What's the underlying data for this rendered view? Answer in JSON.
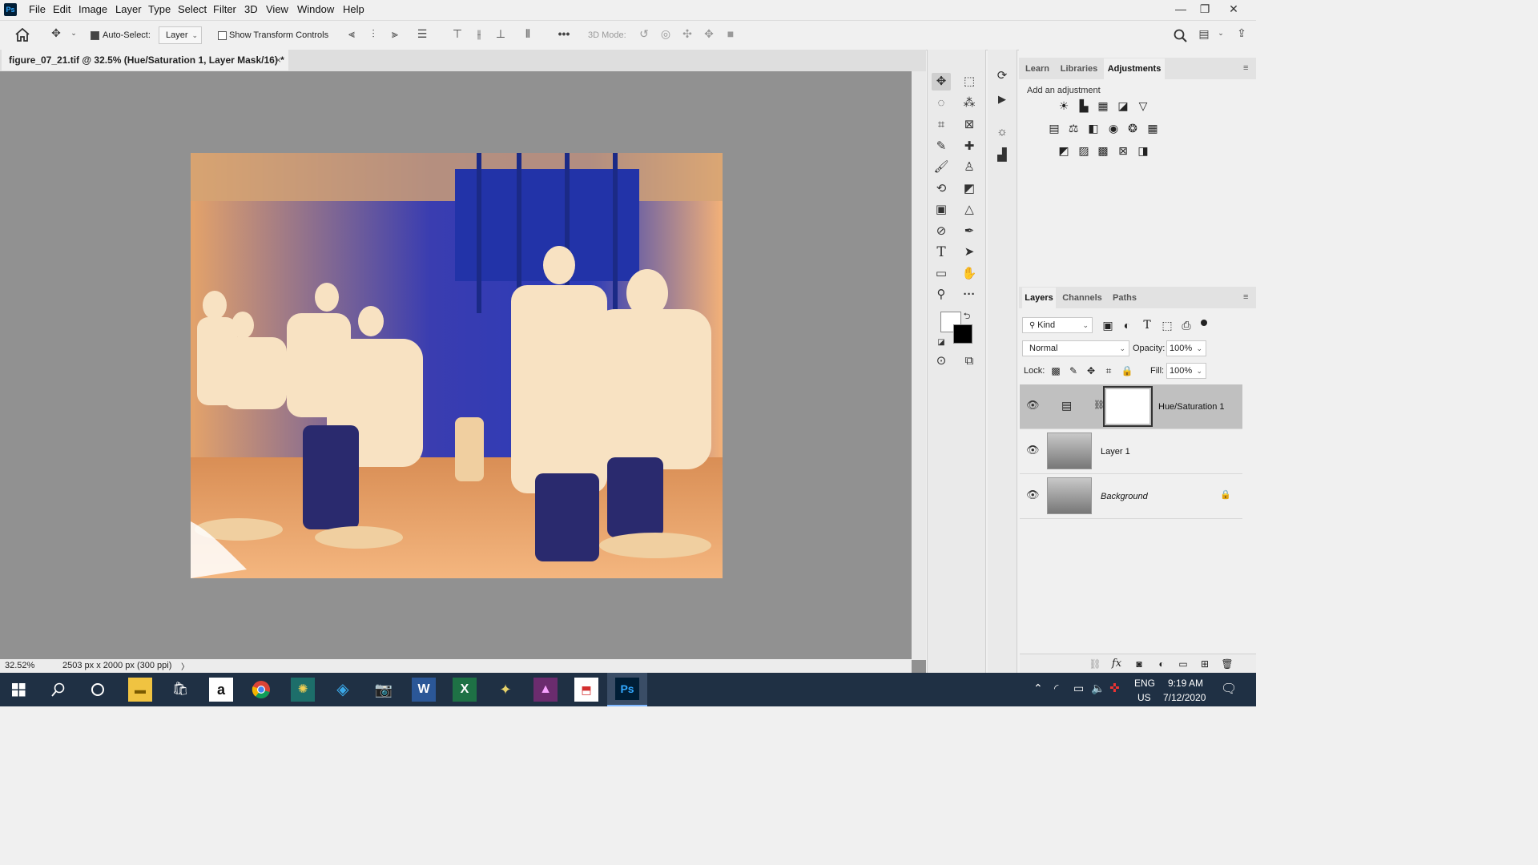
{
  "app": {
    "logo": "Ps"
  },
  "menu": [
    "File",
    "Edit",
    "Image",
    "Layer",
    "Type",
    "Select",
    "Filter",
    "3D",
    "View",
    "Window",
    "Help"
  ],
  "window_controls": {
    "minimize": "—",
    "restore": "❐",
    "close": "✕"
  },
  "options_bar": {
    "auto_select_label": "Auto-Select:",
    "auto_select_checked": true,
    "auto_select_value": "Layer",
    "transform_label": "Show Transform Controls",
    "transform_checked": false,
    "more_label": "•••",
    "mode_label": "3D Mode:"
  },
  "document": {
    "tab_title": "figure_07_21.tif @ 32.5% (Hue/Saturation 1, Layer Mask/16) *",
    "close_glyph": "×"
  },
  "status": {
    "zoom": "32.52%",
    "dimensions": "2503 px x 2000 px (300 ppi)",
    "arrow": "〉"
  },
  "adjustments_panel": {
    "tabs": [
      "Learn",
      "Libraries",
      "Adjustments"
    ],
    "active_tab": "Adjustments",
    "hint": "Add an adjustment"
  },
  "layers_panel": {
    "tabs": [
      "Layers",
      "Channels",
      "Paths"
    ],
    "active_tab": "Layers",
    "filter_kind": "Kind",
    "blend_mode": "Normal",
    "opacity_label": "Opacity:",
    "opacity_value": "100%",
    "lock_label": "Lock:",
    "fill_label": "Fill:",
    "fill_value": "100%",
    "layers": [
      {
        "name": "Hue/Saturation 1",
        "selected": true
      },
      {
        "name": "Layer 1",
        "selected": false
      },
      {
        "name": "Background",
        "selected": false,
        "locked": true
      }
    ],
    "footer_icons": [
      "link-icon",
      "fx-icon",
      "mask-icon",
      "adjustment-icon",
      "folder-icon",
      "new-layer-icon",
      "trash-icon"
    ],
    "fx_label": "fx"
  },
  "taskbar": {
    "time": "9:19 AM",
    "date": "7/12/2020",
    "lang": "ENG",
    "region": "US",
    "ps_label": "Ps"
  }
}
